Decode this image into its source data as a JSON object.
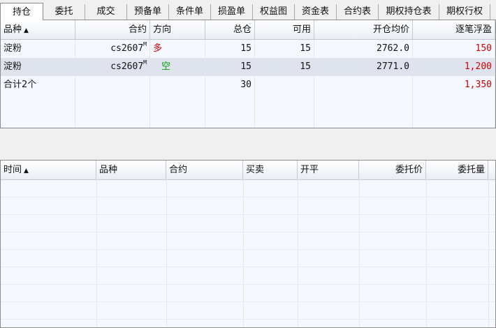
{
  "tabs": [
    "持仓",
    "委托",
    "成交",
    "预备单",
    "条件单",
    "损盈单",
    "权益图",
    "资金表",
    "合约表",
    "期权持仓表",
    "期权行权"
  ],
  "positions": {
    "headers": {
      "product": "品种",
      "contract": "合约",
      "direction": "方向",
      "total": "总仓",
      "available": "可用",
      "avg_price": "开仓均价",
      "float_pnl": "逐笔浮盈"
    },
    "sort_indicator": "▲",
    "rows": [
      {
        "product": "淀粉",
        "contract": "cs2607",
        "contract_tag": "M",
        "direction": "多",
        "total": "15",
        "available": "15",
        "avg_price": "2762.0",
        "float_pnl": "150"
      },
      {
        "product": "淀粉",
        "contract": "cs2607",
        "contract_tag": "M",
        "direction": "空",
        "total": "15",
        "available": "15",
        "avg_price": "2771.0",
        "float_pnl": "1,200"
      }
    ],
    "summary": {
      "label": "合计2个",
      "total": "30",
      "float_pnl": "1,350"
    }
  },
  "orders": {
    "headers": {
      "time": "时间",
      "product": "品种",
      "contract": "合约",
      "side": "买卖",
      "open_close": "开平",
      "order_price": "委托价",
      "order_qty": "委托量"
    },
    "sort_indicator": "▲"
  },
  "colors": {
    "long": "#d00000",
    "short": "#00a000",
    "profit": "#d00000"
  }
}
